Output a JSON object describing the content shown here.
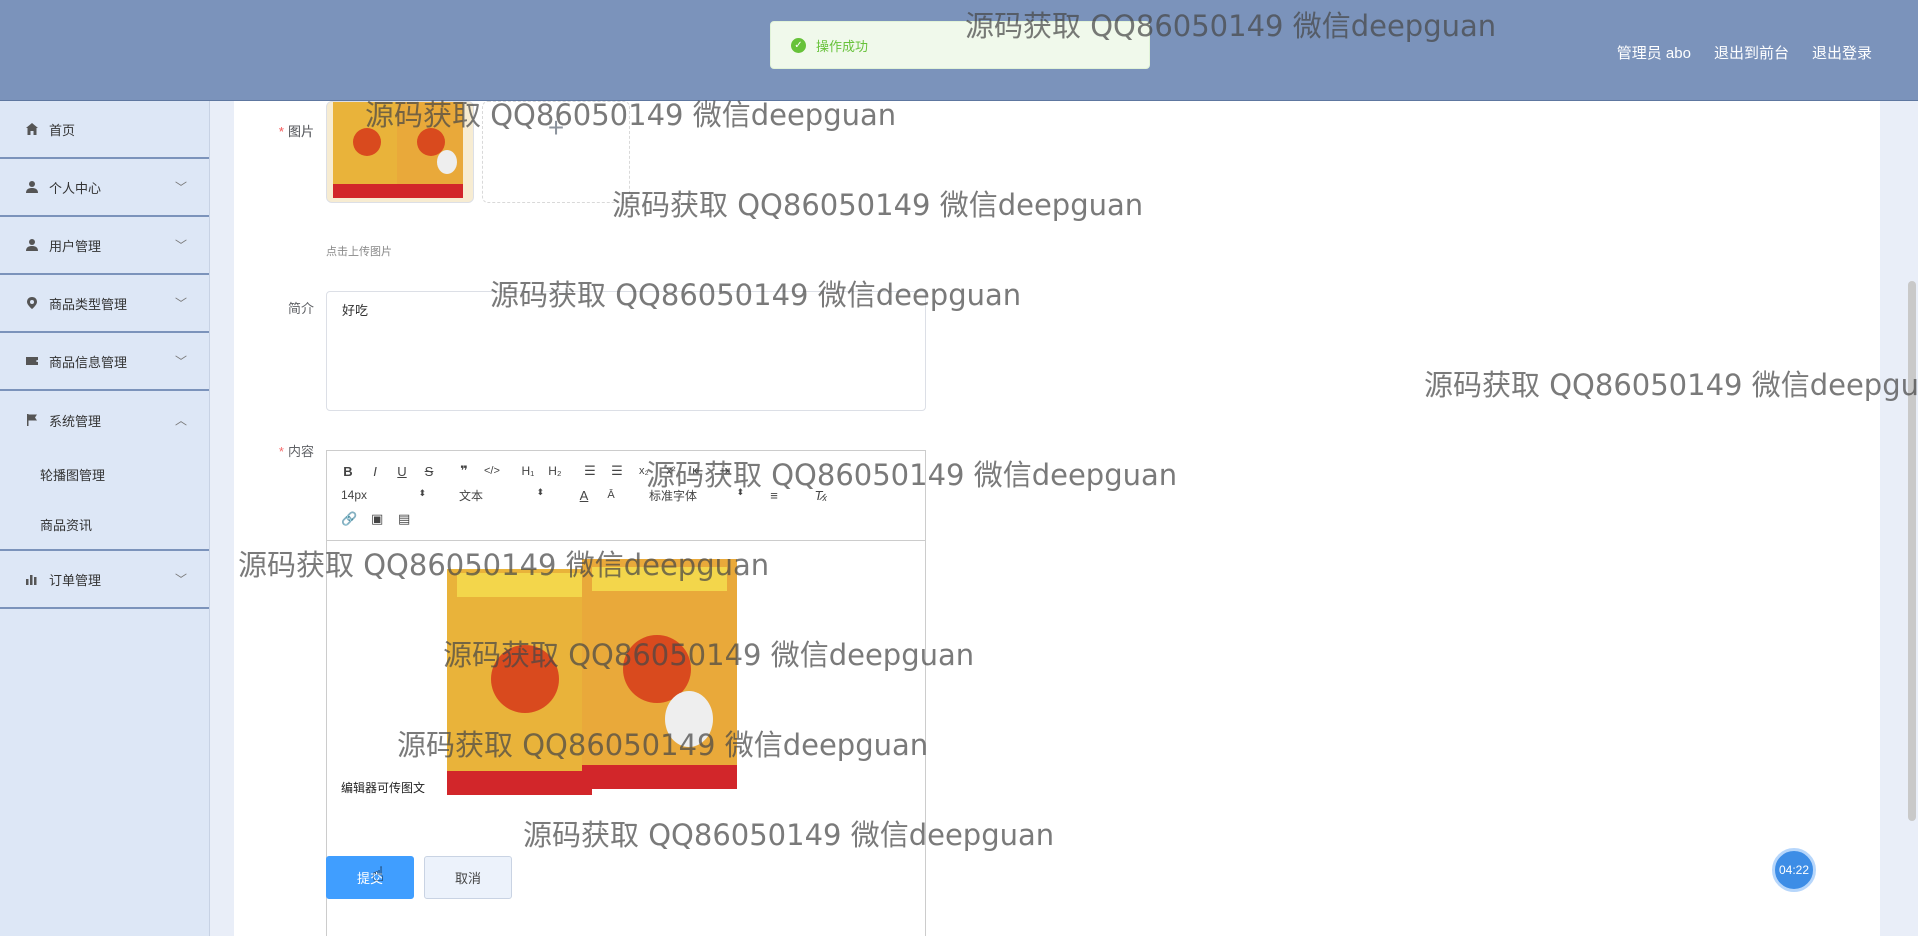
{
  "header": {
    "links": [
      "管理员 abo",
      "退出到前台",
      "退出登录"
    ],
    "toast_text": "操作成功"
  },
  "sidebar": {
    "items": [
      {
        "label": "首页",
        "icon": "home-icon",
        "expandable": false
      },
      {
        "label": "个人中心",
        "icon": "user-icon",
        "expandable": true
      },
      {
        "label": "用户管理",
        "icon": "user-icon",
        "expandable": true
      },
      {
        "label": "商品类型管理",
        "icon": "location-icon",
        "expandable": true
      },
      {
        "label": "商品信息管理",
        "icon": "ticket-icon",
        "expandable": true
      },
      {
        "label": "系统管理",
        "icon": "flag-icon",
        "expandable": true,
        "expanded": true
      },
      {
        "label": "订单管理",
        "icon": "bar-chart-icon",
        "expandable": true
      }
    ],
    "sub_items": [
      "轮播图管理",
      "商品资讯"
    ]
  },
  "form": {
    "image_label": "图片",
    "upload_hint": "点击上传图片",
    "intro_label": "简介",
    "intro_value": "好吃",
    "content_label": "内容",
    "editor": {
      "font_size": "14px",
      "paragraph": "文本",
      "font_family": "标准字体",
      "text": "编辑器可传图文"
    },
    "submit_label": "提交",
    "cancel_label": "取消"
  },
  "timer": "04:22",
  "watermark": "源码获取 QQ86050149 微信deepguan",
  "colors": {
    "header_bg": "#7b93bb",
    "sidebar_bg": "#dde7f6",
    "primary": "#409eff",
    "success": "#67c23a",
    "required": "#f56c6c"
  }
}
